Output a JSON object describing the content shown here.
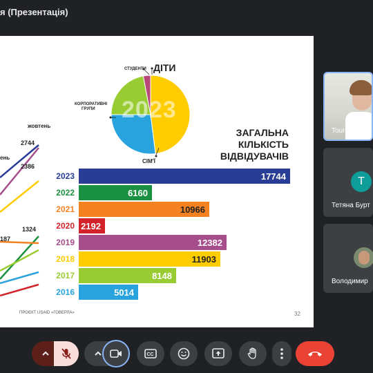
{
  "window": {
    "title": "я (Презентація)"
  },
  "slide": {
    "pie": {
      "year_label": "2023",
      "labels": {
        "students": "СТУДЕНТИ",
        "kids": "ДІТИ",
        "corporate_line1": "КОРПОРАТИВНІ",
        "corporate_line2": "ГРУПИ",
        "families": "СІМ'Ї"
      },
      "slices": [
        {
          "name": "kids",
          "color": "#ffcc00",
          "fraction": 0.48
        },
        {
          "name": "families",
          "color": "#29a3dd",
          "fraction": 0.27
        },
        {
          "name": "corporate",
          "color": "#99cc33",
          "fraction": 0.22
        },
        {
          "name": "students",
          "color": "#b8477a",
          "fraction": 0.03
        }
      ]
    },
    "heading": {
      "line1": "ЗАГАЛЬНА",
      "line2": "КІЛЬКІСТЬ",
      "line3": "ВІДВІДУВАЧІВ"
    },
    "line_chart_partial": {
      "month_label": "жовтень",
      "partial_label": "ень",
      "values": [
        "2744",
        "2386",
        "1324",
        "187"
      ]
    },
    "footer": "ПРОЄКТ USAID «ГОВЕРЛА»",
    "page_number": "32"
  },
  "chart_data": {
    "type": "bar",
    "title": "ЗАГАЛЬНА КІЛЬКІСТЬ ВІДВІДУВАЧІВ",
    "categories": [
      "2023",
      "2022",
      "2021",
      "2020",
      "2019",
      "2018",
      "2017",
      "2016"
    ],
    "values": [
      17744,
      6160,
      10966,
      2192,
      12382,
      11903,
      8148,
      5014
    ],
    "colors": [
      "#293d97",
      "#1a9142",
      "#f58220",
      "#d2232a",
      "#a64d8c",
      "#ffcc00",
      "#99cc33",
      "#29a3dd"
    ],
    "value_text_colors": [
      "#ffffff",
      "#ffffff",
      "#222222",
      "#ffffff",
      "#ffffff",
      "#222222",
      "#ffffff",
      "#ffffff"
    ],
    "xlim": [
      0,
      17744
    ]
  },
  "participants": [
    {
      "name": "Tourist Asso",
      "type": "video",
      "highlighted": true
    },
    {
      "name": "Тетяна Бурт",
      "type": "avatar",
      "initial": "T",
      "color": "#0f9d9a"
    },
    {
      "name": "Володимир",
      "type": "video"
    }
  ],
  "controls": {
    "icons": [
      "chevron-up-icon",
      "mic-off-icon",
      "chevron-up-icon",
      "camera-icon",
      "captions-icon",
      "emoji-icon",
      "present-icon",
      "raise-hand-icon",
      "more-vert-icon",
      "end-call-icon"
    ],
    "colors": {
      "mic_off_bg": "#f9dedc",
      "mic_off_fg": "#8c1d18",
      "end_call": "#ea4335",
      "camera_ring": "#8ab4f8"
    }
  }
}
